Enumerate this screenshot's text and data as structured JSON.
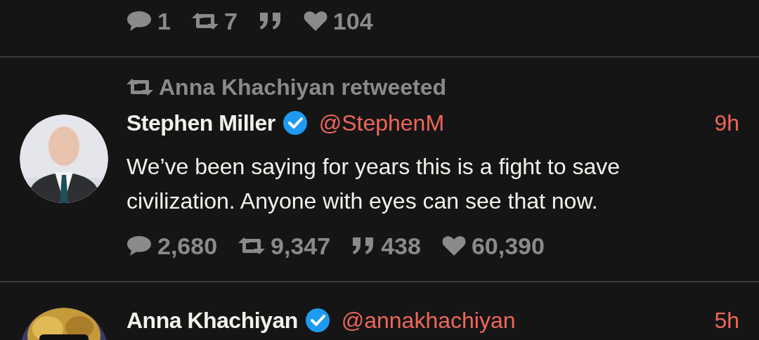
{
  "tweets": [
    {
      "stats": [
        {
          "kind": "reply",
          "count": "1"
        },
        {
          "kind": "retweet",
          "count": "7"
        },
        {
          "kind": "quote"
        },
        {
          "kind": "like",
          "count": "104"
        }
      ]
    },
    {
      "retweeted_by": "Anna Khachiyan retweeted",
      "name": "Stephen Miller",
      "verified": true,
      "handle": "@StephenM",
      "time": "9h",
      "text": "We’ve been saying for years this is a fight to save civilization. Anyone with eyes can see that now.",
      "stats": [
        {
          "kind": "reply",
          "count": "2,680"
        },
        {
          "kind": "retweet",
          "count": "9,347"
        },
        {
          "kind": "quote",
          "count": "438"
        },
        {
          "kind": "like",
          "count": "60,390"
        }
      ]
    },
    {
      "name": "Anna Khachiyan",
      "verified": true,
      "handle": "@annakhachiyan",
      "time": "5h"
    }
  ]
}
